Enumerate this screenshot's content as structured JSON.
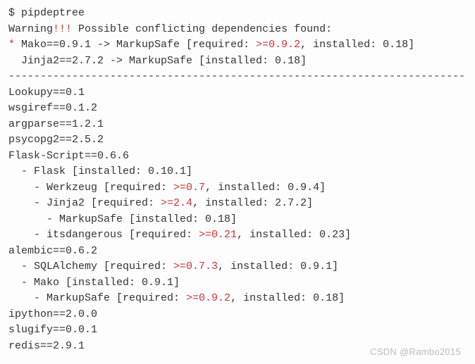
{
  "prompt": "$ ",
  "command": "pipdeptree",
  "warning_prefix": "Warning",
  "warning_bang": "!!!",
  "warning_text": " Possible conflicting dependencies found:",
  "conflict_marker": "* ",
  "conflict1_a": "Mako==0.9.1 -> MarkupSafe [required: ",
  "conflict1_b": ">=0.9.2",
  "conflict1_c": ", installed: 0.18]",
  "conflict2": "  Jinja2==2.7.2 -> MarkupSafe [installed: 0.18]",
  "separator": "------------------------------------------------------------------------",
  "tree": {
    "l0": "Lookupy==0.1",
    "l1": "wsgiref==0.1.2",
    "l2": "argparse==1.2.1",
    "l3": "psycopg2==2.5.2",
    "l4": "Flask-Script==0.6.6",
    "l5": "  - Flask [installed: 0.10.1]",
    "l6a": "    - Werkzeug [required: ",
    "l6b": ">=0.7",
    "l6c": ", installed: 0.9.4]",
    "l7a": "    - Jinja2 [required: ",
    "l7b": ">=2.4",
    "l7c": ", installed: 2.7.2]",
    "l8": "      - MarkupSafe [installed: 0.18]",
    "l9a": "    - itsdangerous [required: ",
    "l9b": ">=0.21",
    "l9c": ", installed: 0.23]",
    "l10": "alembic==0.6.2",
    "l11a": "  - SQLAlchemy [required: ",
    "l11b": ">=0.7.3",
    "l11c": ", installed: 0.9.1]",
    "l12": "  - Mako [installed: 0.9.1]",
    "l13a": "    - MarkupSafe [required: ",
    "l13b": ">=0.9.2",
    "l13c": ", installed: 0.18]",
    "l14": "ipython==2.0.0",
    "l15": "slugify==0.0.1",
    "l16": "redis==2.9.1"
  },
  "watermark": "CSDN @Rambo2015"
}
